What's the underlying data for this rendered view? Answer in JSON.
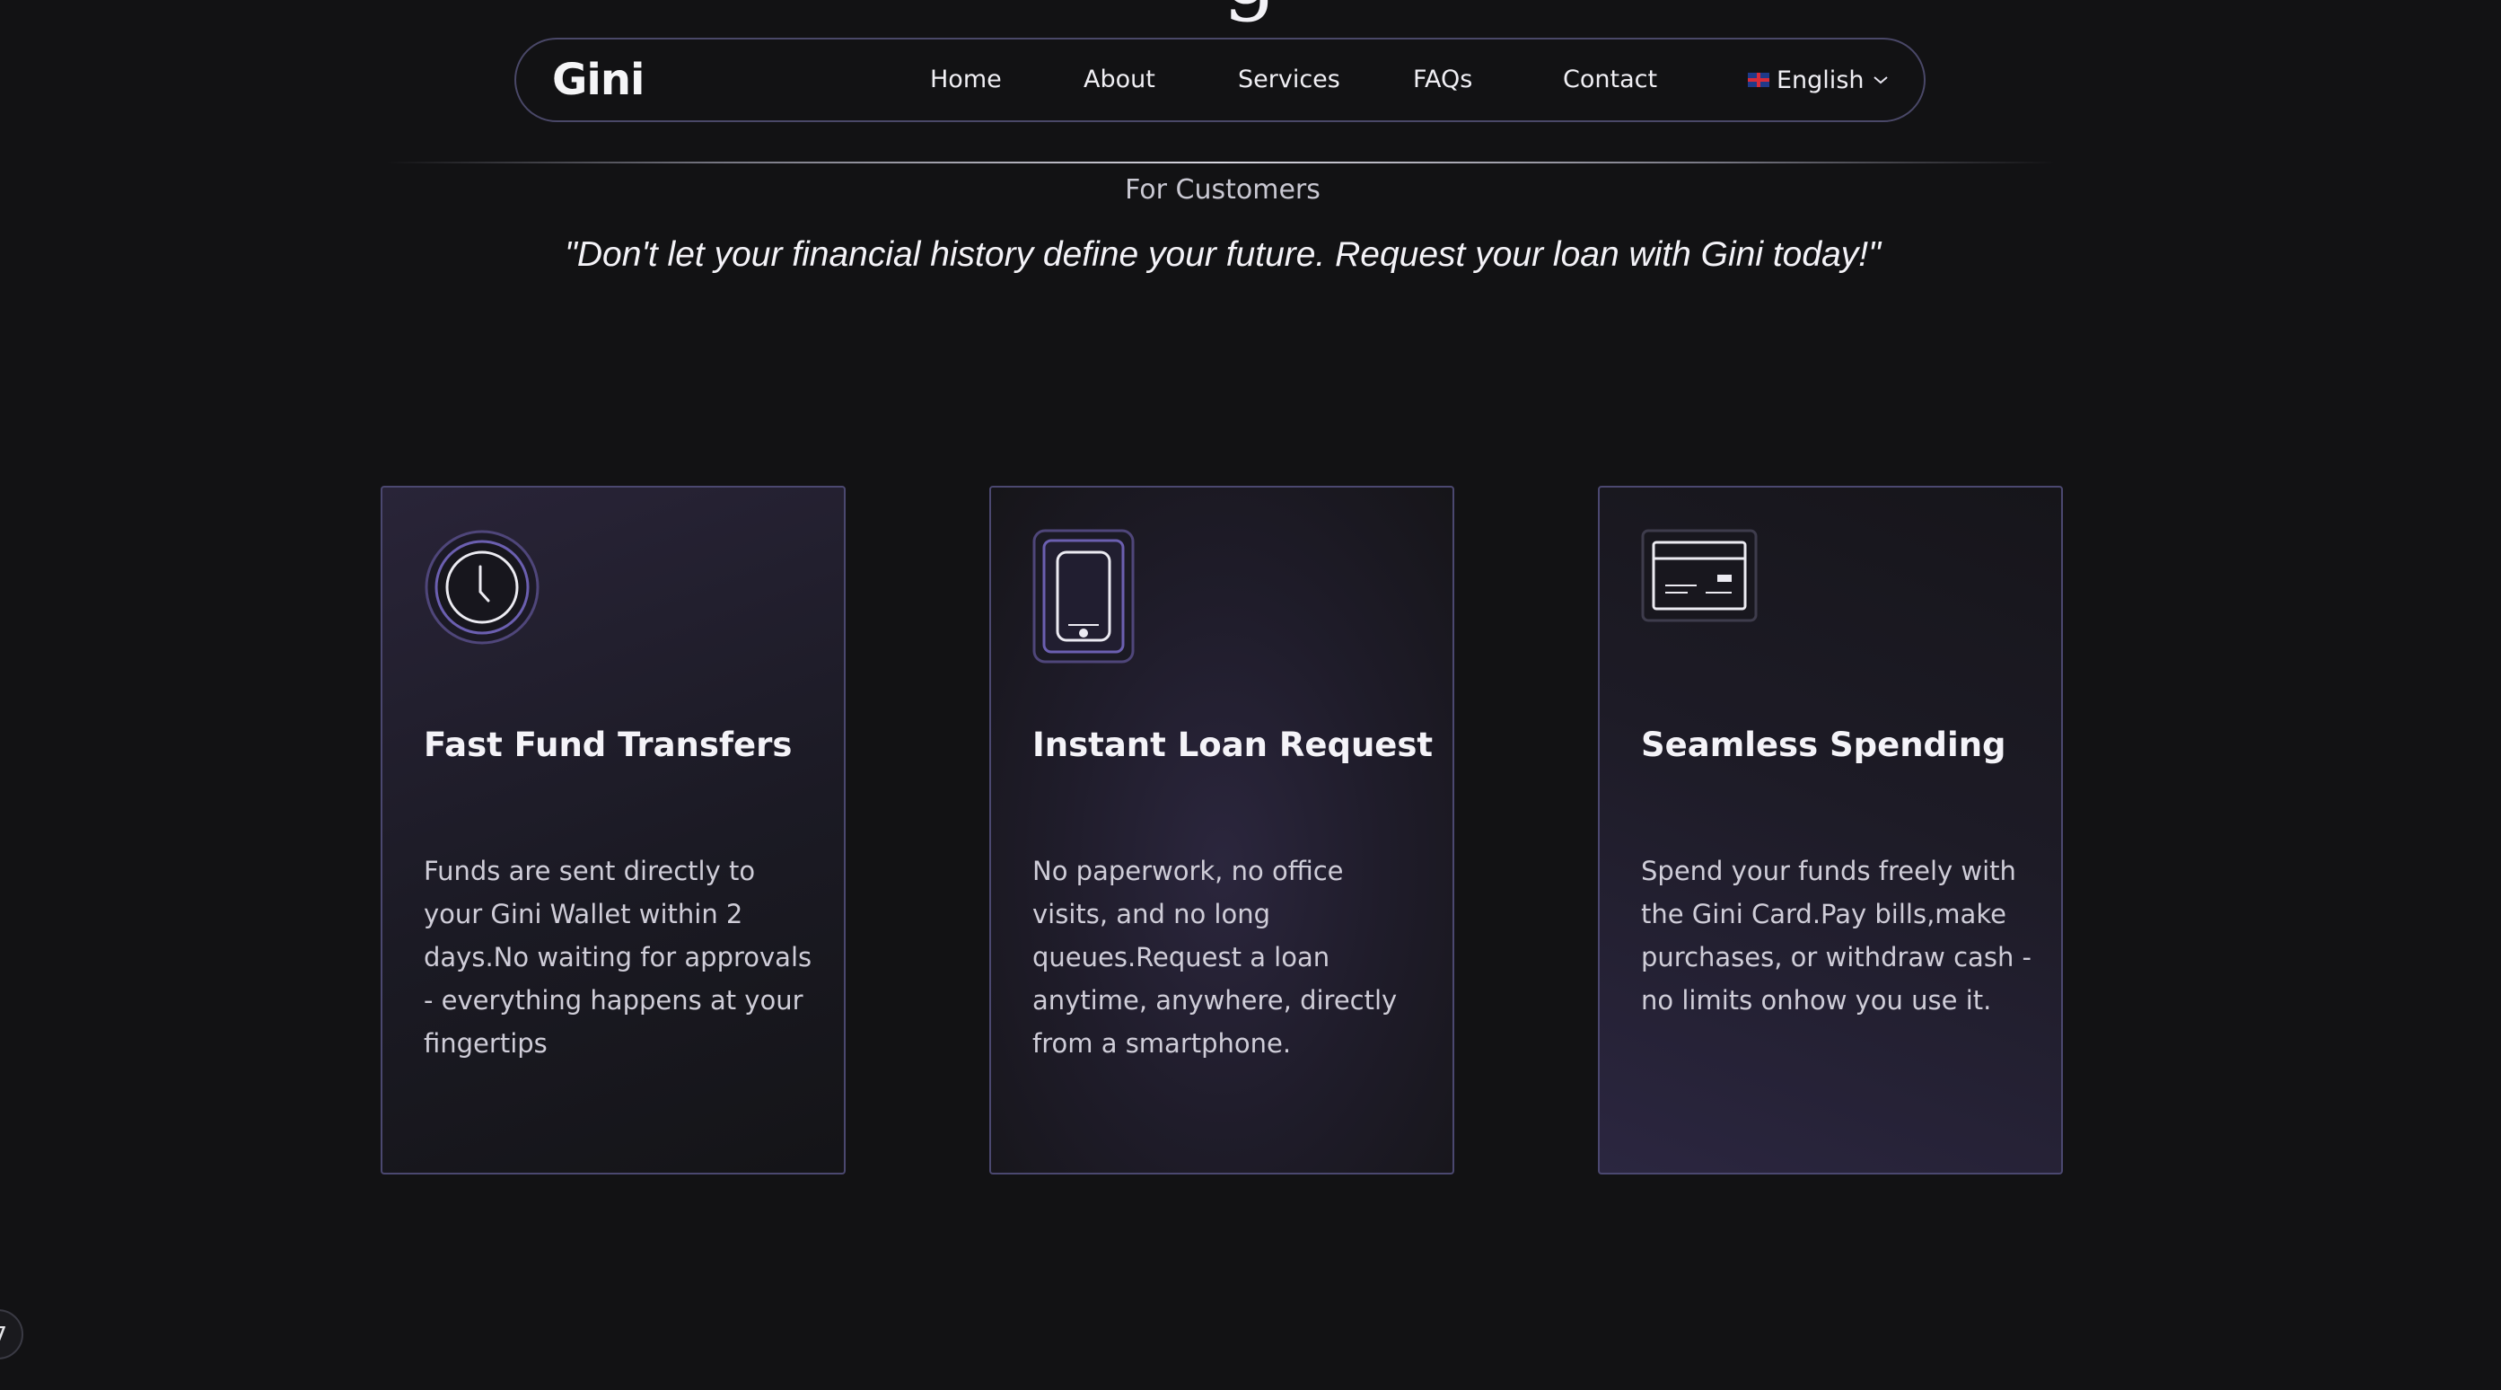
{
  "nav": {
    "logo": "Gini",
    "links": [
      "Home",
      "About",
      "Services",
      "FAQs",
      "Contact"
    ],
    "language": "English",
    "language_icon": "uk-flag-icon",
    "language_caret": "chevron-down-icon"
  },
  "section": {
    "eyebrow": "For Customers",
    "quote": "\"Don't let your financial history define your future. Request your loan with Gini today!\""
  },
  "cards": [
    {
      "icon": "clock-icon",
      "title": "Fast Fund Transfers",
      "text": "Funds are sent directly to your Gini Wallet within 2 days.No waiting for approvals - everything happens at your fingertips"
    },
    {
      "icon": "smartphone-icon",
      "title": "Instant Loan Request",
      "text": "No paperwork, no office visits, and no long queues.Request a loan anytime, anywhere, directly from a smartphone."
    },
    {
      "icon": "card-icon",
      "title": "Seamless Spending",
      "text": "Spend your funds freely with the Gini Card.Pay bills,make purchases, or withdraw cash - no limits onhow you use it."
    }
  ],
  "corner_badge": "7",
  "colors": {
    "background": "#121214",
    "card_border": "#4b4870",
    "accent": "#6b5fb0"
  }
}
